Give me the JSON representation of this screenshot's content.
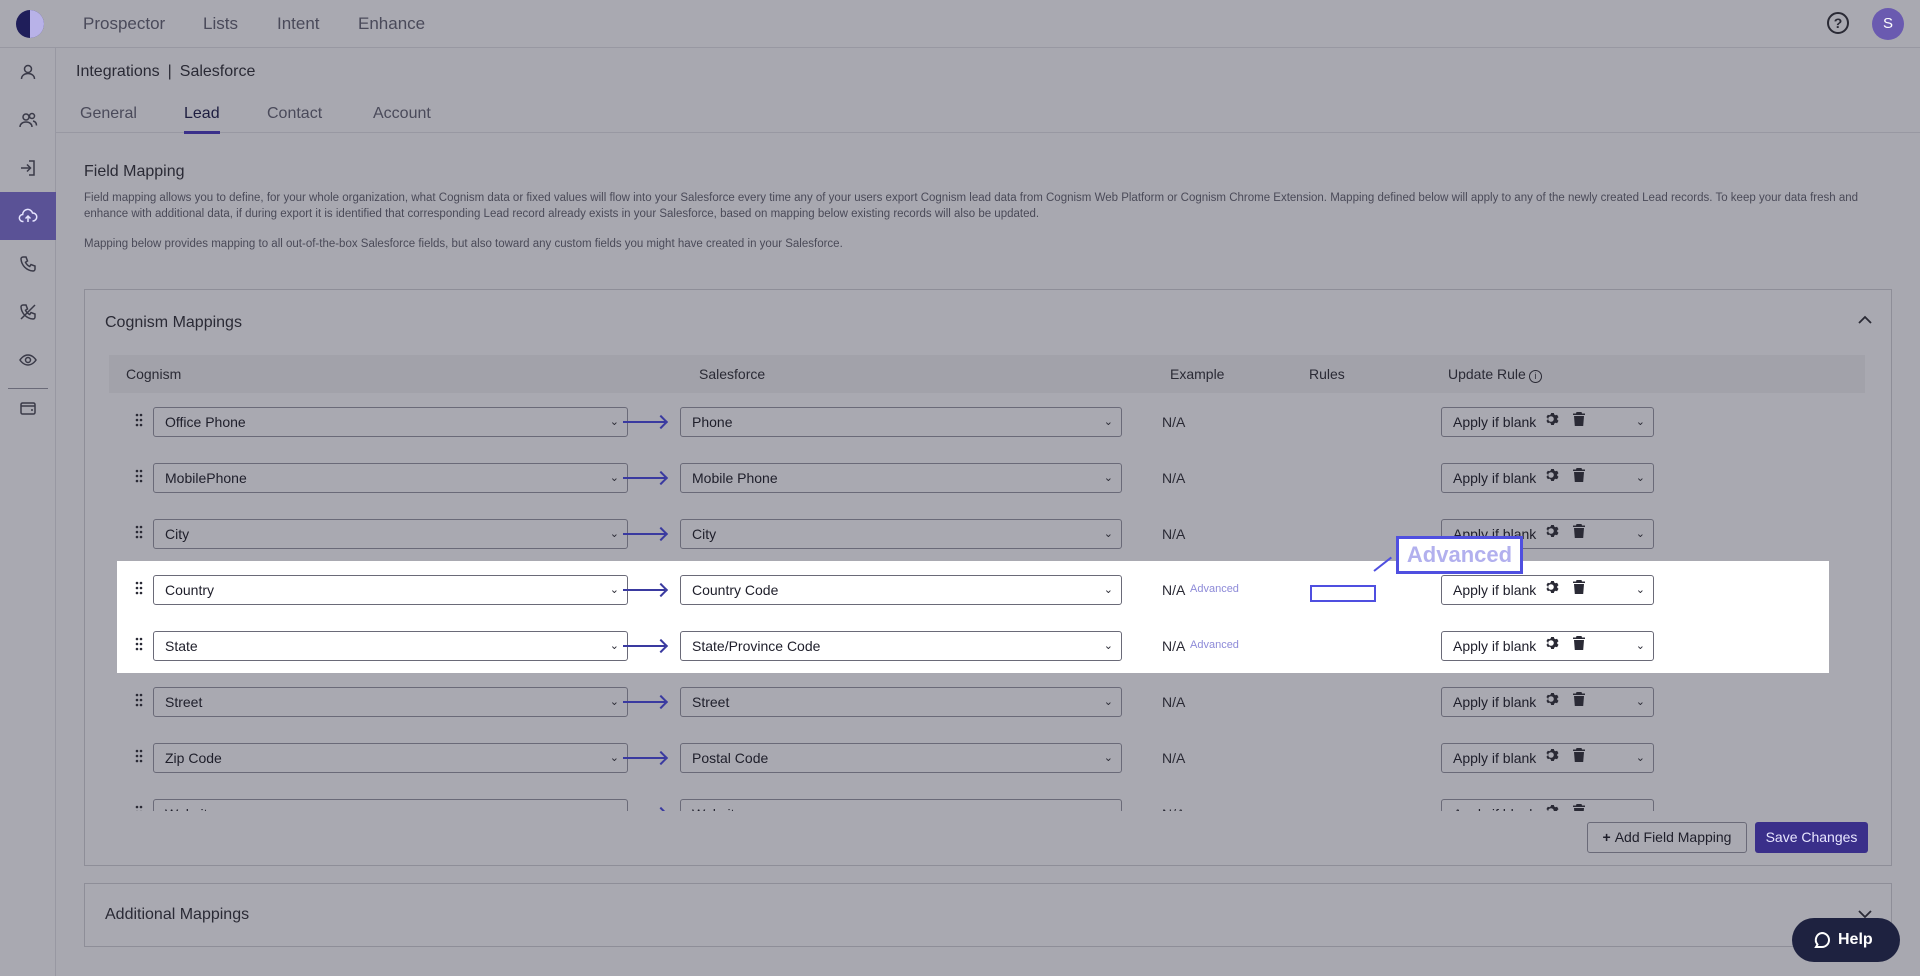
{
  "topnav": {
    "items": [
      "Prospector",
      "Lists",
      "Intent",
      "Enhance"
    ],
    "help_glyph": "?",
    "avatar_initial": "S"
  },
  "breadcrumb": {
    "parent": "Integrations",
    "separator": "|",
    "current": "Salesforce"
  },
  "tabs": [
    "General",
    "Lead",
    "Contact",
    "Account"
  ],
  "active_tab": "Lead",
  "field_mapping": {
    "title": "Field Mapping",
    "description": "Field mapping allows you to define, for your whole organization, what Cognism data or fixed values will flow into your Salesforce every time any of your users export Cognism lead data from Cognism Web Platform or Cognism Chrome Extension. Mapping defined below will apply to any of the newly created Lead records. To keep your data fresh and enhance with additional data, if during export it is identified that corresponding Lead record already exists in your Salesforce, based on mapping below existing records will also be updated.",
    "description2": "Mapping below provides mapping to all out-of-the-box Salesforce fields, but also toward any custom fields you might have created in your Salesforce."
  },
  "cognism_mappings": {
    "title": "Cognism Mappings",
    "columns": {
      "cognism": "Cognism",
      "salesforce": "Salesforce",
      "example": "Example",
      "rules": "Rules",
      "update_rule": "Update Rule",
      "info_glyph": "i"
    },
    "rows": [
      {
        "cognism": "Office Phone",
        "salesforce": "Phone",
        "example": "N/A",
        "rules": "",
        "update_rule": "Apply if blank",
        "highlighted": false
      },
      {
        "cognism": "MobilePhone",
        "salesforce": "Mobile Phone",
        "example": "N/A",
        "rules": "",
        "update_rule": "Apply if blank",
        "highlighted": false
      },
      {
        "cognism": "City",
        "salesforce": "City",
        "example": "N/A",
        "rules": "",
        "update_rule": "Apply if blank",
        "highlighted": false
      },
      {
        "cognism": "Country",
        "salesforce": "Country Code",
        "example": "N/A",
        "rules": "Advanced",
        "update_rule": "Apply if blank",
        "highlighted": true
      },
      {
        "cognism": "State",
        "salesforce": "State/Province Code",
        "example": "N/A",
        "rules": "Advanced",
        "update_rule": "Apply if blank",
        "highlighted": true
      },
      {
        "cognism": "Street",
        "salesforce": "Street",
        "example": "N/A",
        "rules": "",
        "update_rule": "Apply if blank",
        "highlighted": false
      },
      {
        "cognism": "Zip Code",
        "salesforce": "Postal Code",
        "example": "N/A",
        "rules": "",
        "update_rule": "Apply if blank",
        "highlighted": false
      },
      {
        "cognism": "Website",
        "salesforce": "Website",
        "example": "N/A",
        "rules": "",
        "update_rule": "Apply if blank",
        "highlighted": false
      }
    ],
    "add_button": "Add Field Mapping",
    "save_button": "Save Changes"
  },
  "additional_mappings": {
    "title": "Additional Mappings"
  },
  "help_button": "Help",
  "callout": {
    "label": "Advanced"
  },
  "colors": {
    "accent": "#3a2f8a",
    "link": "#8d8ad8",
    "callout": "#4f4fe0"
  },
  "icons": {
    "sidebar": [
      "person-icon",
      "people-icon",
      "sign-in-icon",
      "cloud-upload-icon",
      "phone-icon",
      "phone-off-icon",
      "eye-icon",
      "wallet-icon"
    ]
  }
}
